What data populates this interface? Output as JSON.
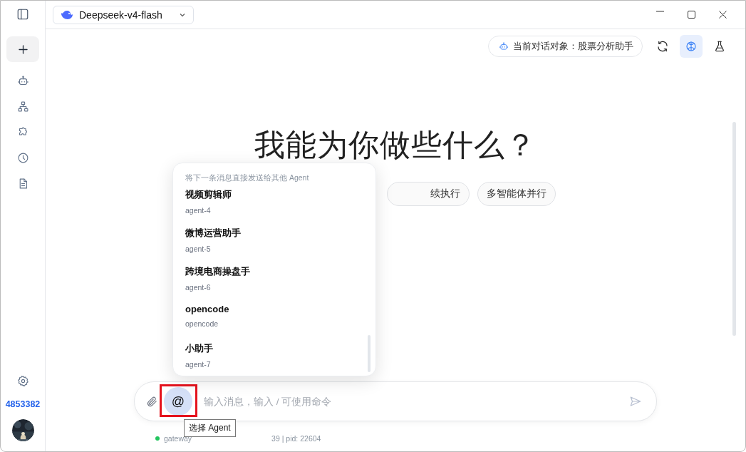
{
  "topbar": {
    "model": "Deepseek-v4-flash"
  },
  "sidebar": {
    "items": [
      {
        "kind": "new"
      },
      {
        "kind": "robot"
      },
      {
        "kind": "hierarchy"
      },
      {
        "kind": "puzzle"
      },
      {
        "kind": "clock"
      },
      {
        "kind": "document"
      }
    ],
    "user_id": "4853382"
  },
  "header": {
    "target_label": "当前对话对象：股票分析助手",
    "tools": [
      {
        "kind": "refresh",
        "selected": false
      },
      {
        "kind": "brain",
        "selected": true
      },
      {
        "kind": "flask",
        "selected": false
      }
    ]
  },
  "hero": {
    "title": "我能为你做些什么？",
    "chips": [
      "续执行",
      "多智能体并行"
    ]
  },
  "agent_menu": {
    "heading": "将下一条消息直接发送给其他 Agent",
    "agents": [
      {
        "name": "视频剪辑师",
        "id": "agent-4"
      },
      {
        "name": "微博运营助手",
        "id": "agent-5"
      },
      {
        "name": "跨境电商操盘手",
        "id": "agent-6"
      },
      {
        "name": "opencode",
        "id": "opencode"
      },
      {
        "name": "小助手",
        "id": "agent-7"
      }
    ]
  },
  "input": {
    "placeholder": "输入消息，输入 / 可使用命令",
    "agent_button": {
      "label": "@",
      "highlighted": true
    },
    "tooltip": "选择 Agent"
  },
  "status": {
    "online": true,
    "left": "gateway",
    "right": "39 | pid: 22604"
  }
}
